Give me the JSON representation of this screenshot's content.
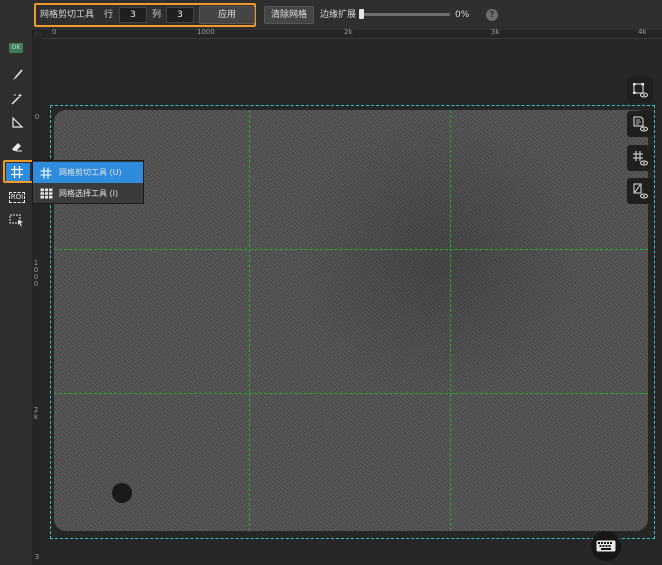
{
  "options_bar": {
    "tool_name": "网格剪切工具",
    "rows_label": "行",
    "rows_value": "3",
    "cols_label": "列",
    "cols_value": "3",
    "apply_label": "应用",
    "clear_grid_label": "清除网格",
    "edge_expand_label": "边缘扩展",
    "edge_expand_value": "0%",
    "edge_expand_fraction": 0,
    "help_icon": "?"
  },
  "tools": {
    "ok_badge": "OK",
    "roi_label": "ROI",
    "items": [
      "brush-icon",
      "magic-wand-icon",
      "polygon-lasso-icon",
      "eraser-icon",
      "grid-icon",
      "roi-icon",
      "region-select-icon"
    ]
  },
  "ruler_top": [
    "0",
    "1000",
    "2k",
    "3k",
    "4k"
  ],
  "ruler_left": [
    "0",
    "1000",
    "2k",
    "3"
  ],
  "flyout": {
    "items": [
      {
        "label": "网格剪切工具 (U)",
        "icon": "grid-cut-icon",
        "selected": true
      },
      {
        "label": "网格选择工具 (I)",
        "icon": "grid-select-icon",
        "selected": false
      }
    ]
  },
  "right_panel": [
    "bbox-view-icon",
    "label-view-icon",
    "grid-view-icon",
    "mask-view-icon"
  ],
  "colors": {
    "highlight": "#f19a2c",
    "selection": "#2f8cdc",
    "grid_line": "#22b022",
    "image_border": "#2ec4c4"
  }
}
